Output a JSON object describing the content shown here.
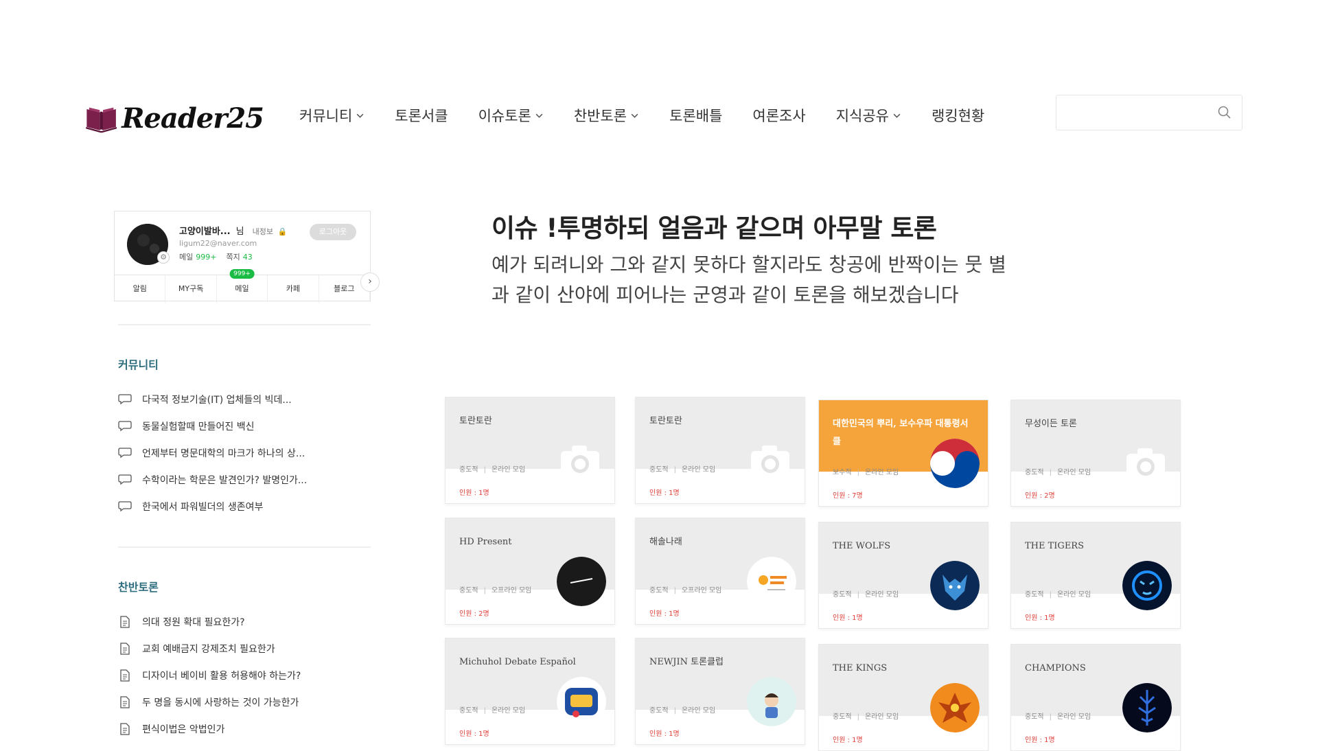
{
  "header": {
    "logo_text": "Reader25",
    "nav": [
      {
        "label": "커뮤니티",
        "has_dropdown": true
      },
      {
        "label": "토론서클",
        "has_dropdown": false
      },
      {
        "label": "이슈토론",
        "has_dropdown": true
      },
      {
        "label": "찬반토론",
        "has_dropdown": true
      },
      {
        "label": "토론배틀",
        "has_dropdown": false
      },
      {
        "label": "여론조사",
        "has_dropdown": false
      },
      {
        "label": "지식공유",
        "has_dropdown": true
      },
      {
        "label": "랭킹현황",
        "has_dropdown": false
      }
    ],
    "search": {
      "value": "",
      "placeholder": "",
      "icon": "search-icon"
    }
  },
  "profile": {
    "nickname": "고양이발바...",
    "suffix": "님",
    "info_label": "내정보",
    "logout_label": "로그아웃",
    "email": "ligum22@naver.com",
    "mail_label": "메일",
    "mail_count": "999+",
    "note_label": "쪽지",
    "note_count": "43",
    "mail_badge": "999+",
    "tabs": [
      "알림",
      "MY구독",
      "메일",
      "카페",
      "블로그"
    ]
  },
  "sidebar": {
    "community": {
      "title": "커뮤니티",
      "items": [
        "다국적 정보기술(IT) 업체들의 빅데...",
        "동물실험할때 만들어진 백신",
        "언제부터 명문대학의 마크가 하나의 상...",
        "수학이라는 학문은 발견인가? 발명인가...",
        "한국에서 파워빌더의 생존여부"
      ]
    },
    "debate": {
      "title": "찬반토론",
      "items": [
        "의대 정원 확대 필요한가?",
        "교회 예배금지 강제조치 필요한가",
        "디자이너 베이비 활용 허용해야 하는가?",
        "두 명을 동시에 사랑하는 것이 가능한가",
        "편식이법은 악법인가"
      ]
    }
  },
  "hero": {
    "title": "이슈 !투명하되 얼음과 같으며 아무말 토론",
    "description_line1": "예가 되려니와 그와 같지 못하다 할지라도 창공에 반짝이는 뭇 별",
    "description_line2": "과 같이 산야에 피어나는 군영과 같이 토론을 해보겠습니다"
  },
  "cards": [
    {
      "name": "토란토란",
      "type": "중도적",
      "mode": "온라인 모임",
      "count": "인원 : 1명",
      "image": "camera-placeholder",
      "head_color": "#ececec"
    },
    {
      "name": "토란토란",
      "type": "중도적",
      "mode": "온라인 모임",
      "count": "인원 : 1명",
      "image": "camera-placeholder",
      "head_color": "#ececec"
    },
    {
      "name": "대한민국의 뿌리, 보수우파 대통령서클",
      "type": "보수적",
      "mode": "온라인 모임",
      "count": "인원 : 7명",
      "image": "taegeuk-logo",
      "head_color": "#f5a43b"
    },
    {
      "name": "무성이든 토론",
      "type": "중도적",
      "mode": "온라인 모임",
      "count": "인원 : 2명",
      "image": "camera-placeholder",
      "head_color": "#ececec"
    },
    {
      "name": "HD Present",
      "type": "중도적",
      "mode": "오프라인 모임",
      "count": "인원 : 2명",
      "image": "hd-present-logo",
      "head_color": "#ececec"
    },
    {
      "name": "해솔나래",
      "type": "중도적",
      "mode": "오프라인 모임",
      "count": "인원 : 1명",
      "image": "haesol-logo",
      "head_color": "#ececec"
    },
    {
      "name": "THE WOLFS",
      "type": "중도적",
      "mode": "온라인 모임",
      "count": "인원 : 1명",
      "image": "wolf-logo",
      "head_color": "#ececec"
    },
    {
      "name": "THE TIGERS",
      "type": "중도적",
      "mode": "온라인 모임",
      "count": "인원 : 1명",
      "image": "tiger-logo",
      "head_color": "#ececec"
    },
    {
      "name": "Michuhol Debate Español",
      "type": "중도적",
      "mode": "온라인 모임",
      "count": "인원 : 1명",
      "image": "michuhol-logo",
      "head_color": "#ececec"
    },
    {
      "name": "NEWJIN 토론클럽",
      "type": "중도적",
      "mode": "온라인 모임",
      "count": "인원 : 1명",
      "image": "newjin-logo",
      "head_color": "#ececec"
    },
    {
      "name": "THE KINGS",
      "type": "중도적",
      "mode": "온라인 모임",
      "count": "인원 : 1명",
      "image": "phoenix-logo",
      "head_color": "#ececec"
    },
    {
      "name": "CHAMPIONS",
      "type": "중도적",
      "mode": "온라인 모임",
      "count": "인원 : 1명",
      "image": "champions-logo",
      "head_color": "#ececec"
    }
  ],
  "colors": {
    "accent_green": "#1bbc45",
    "section_title": "#2d6d7e",
    "count_red": "#e0413b",
    "logo_book": "#7b1f4b",
    "featured_card": "#f5a43b"
  }
}
